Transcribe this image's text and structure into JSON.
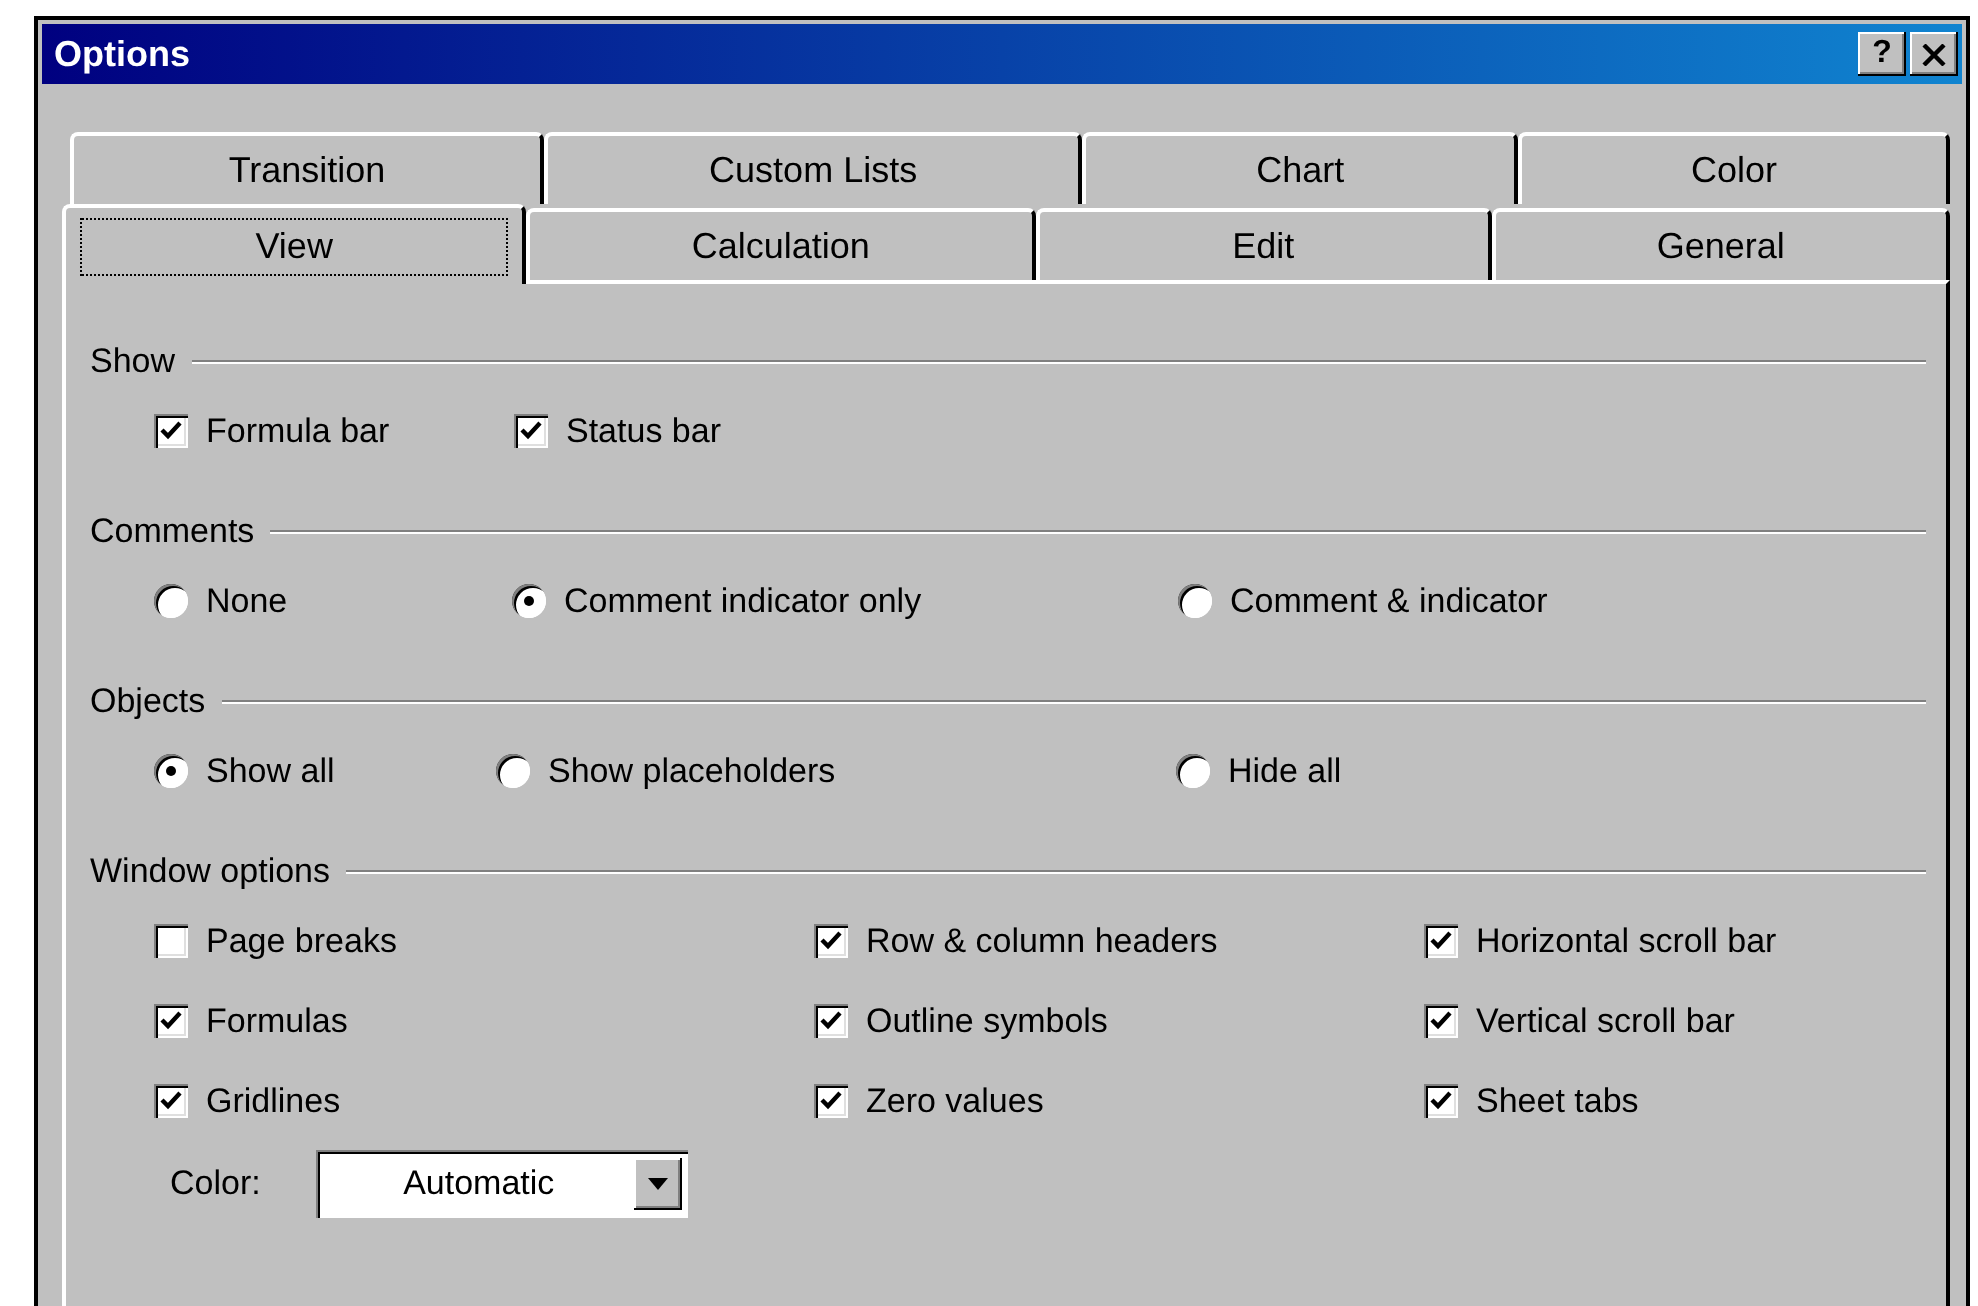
{
  "window": {
    "title": "Options"
  },
  "title_buttons": [
    {
      "kind": "help",
      "label": "?"
    },
    {
      "kind": "close"
    }
  ],
  "tab_rows": [
    [
      {
        "label": "Transition",
        "selected": false
      },
      {
        "label": "Custom Lists",
        "selected": false
      },
      {
        "label": "Chart",
        "selected": false
      },
      {
        "label": "Color",
        "selected": false
      }
    ],
    [
      {
        "label": "View",
        "selected": true
      },
      {
        "label": "Calculation",
        "selected": false
      },
      {
        "label": "Edit",
        "selected": false
      },
      {
        "label": "General",
        "selected": false
      }
    ]
  ],
  "sections": [
    {
      "title": "Show",
      "kind": "checkboxes",
      "columns": [
        [
          {
            "label": "Formula bar",
            "checked": true
          }
        ],
        [
          {
            "label": "Status bar",
            "checked": true
          }
        ]
      ]
    },
    {
      "title": "Comments",
      "kind": "radios",
      "columns": [
        [
          {
            "label": "None",
            "selected": false
          }
        ],
        [
          {
            "label": "Comment indicator only",
            "selected": true
          }
        ],
        [
          {
            "label": "Comment & indicator",
            "selected": false
          }
        ]
      ]
    },
    {
      "title": "Objects",
      "kind": "radios",
      "columns": [
        [
          {
            "label": "Show all",
            "selected": true
          }
        ],
        [
          {
            "label": "Show placeholders",
            "selected": false
          }
        ],
        [
          {
            "label": "Hide all",
            "selected": false
          }
        ]
      ]
    },
    {
      "title": "Window options",
      "kind": "checkboxes",
      "columns": [
        [
          {
            "label": "Page breaks",
            "checked": false
          },
          {
            "label": "Formulas",
            "checked": true
          },
          {
            "label": "Gridlines",
            "checked": true
          }
        ],
        [
          {
            "label": "Row & column headers",
            "checked": true
          },
          {
            "label": "Outline symbols",
            "checked": true
          },
          {
            "label": "Zero values",
            "checked": true
          }
        ],
        [
          {
            "label": "Horizontal scroll bar",
            "checked": true
          },
          {
            "label": "Vertical scroll bar",
            "checked": true
          },
          {
            "label": "Sheet tabs",
            "checked": true
          }
        ]
      ],
      "color": {
        "label": "Color:",
        "value": "Automatic"
      }
    }
  ]
}
